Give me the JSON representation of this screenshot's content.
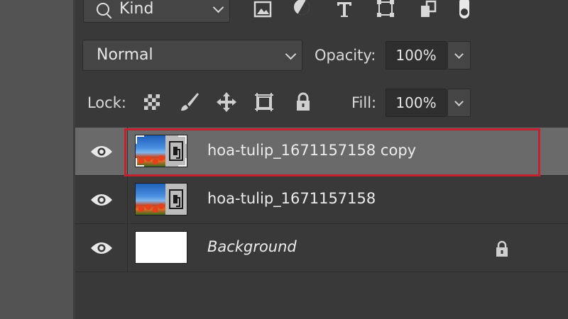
{
  "filter": {
    "kind_label": "Kind",
    "type_icons": [
      "image-filter-icon",
      "adjustment-filter-icon",
      "type-filter-icon",
      "shape-filter-icon",
      "smart-object-filter-icon",
      "filter-toggle-icon"
    ]
  },
  "blend": {
    "mode": "Normal",
    "opacity_label": "Opacity:",
    "opacity_value": "100%"
  },
  "lock": {
    "label": "Lock:",
    "icons": [
      "lock-transparent-pixels-icon",
      "lock-image-pixels-icon",
      "lock-position-icon",
      "lock-artboard-icon",
      "lock-all-icon"
    ],
    "fill_label": "Fill:",
    "fill_value": "100%"
  },
  "layers": [
    {
      "name": "hoa-tulip_1671157158 copy",
      "selected": true,
      "thumb": "smart-object"
    },
    {
      "name": "hoa-tulip_1671157158",
      "selected": false,
      "thumb": "smart-object"
    },
    {
      "name": "Background",
      "selected": false,
      "thumb": "white",
      "locked": true
    }
  ],
  "colors": {
    "panel_bg": "#393939",
    "selected_row": "#6a6a6a",
    "highlight_border": "#c61f2e"
  }
}
